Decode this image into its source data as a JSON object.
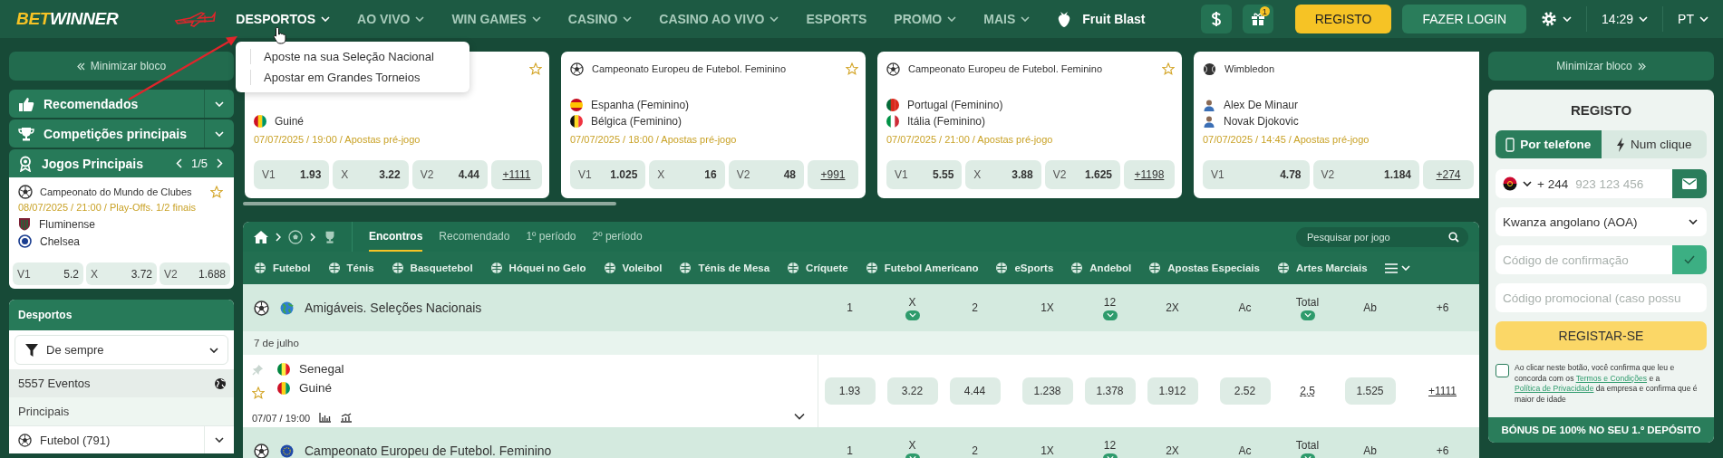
{
  "header": {
    "logo": [
      "BET",
      "WINNER"
    ],
    "nav": [
      {
        "label": "DESPORTOS",
        "selected": true,
        "menu": true
      },
      {
        "label": "AO VIVO",
        "selected": false,
        "menu": true
      },
      {
        "label": "WIN GAMES",
        "selected": false,
        "menu": true
      },
      {
        "label": "CASINO",
        "selected": false,
        "menu": true
      },
      {
        "label": "CASINO AO VIVO",
        "selected": false,
        "menu": true
      },
      {
        "label": "ESPORTS",
        "selected": false,
        "menu": false
      },
      {
        "label": "PROMO",
        "selected": false,
        "menu": true
      },
      {
        "label": "MAIS",
        "selected": false,
        "menu": true
      }
    ],
    "featured": "Fruit Blast",
    "gift_badge": "1",
    "register": "REGISTO",
    "login": "FAZER LOGIN",
    "time": "14:29",
    "language": "PT"
  },
  "nav_dropdown": [
    "Aposte na sua Seleção Nacional",
    "Apostar em Grandes Torneios"
  ],
  "left": {
    "minimize": "Minimizar bloco",
    "sections": [
      "Recomendados",
      "Competições principais"
    ],
    "top_games": {
      "title": "Jogos Principais",
      "page": "1/5",
      "league": "Campeonato do Mundo de Clubes",
      "info": "08/07/2025 / 21:00 / Play-Offs. 1/2 finais",
      "teams": [
        "Fluminense",
        "Chelsea"
      ],
      "odds": [
        {
          "label": "V1",
          "value": "5.2"
        },
        {
          "label": "X",
          "value": "3.72"
        },
        {
          "label": "V2",
          "value": "1.688"
        }
      ]
    },
    "sports": {
      "title": "Desportos",
      "filter": "De sempre",
      "events": "5557 Eventos",
      "group": "Principais",
      "items": [
        "Futebol (791)"
      ]
    }
  },
  "cards": [
    {
      "kind": "football",
      "teams": [
        "Guiné"
      ],
      "info": "07/07/2025 / 19:00 / Apostas pré-jogo",
      "odds": [
        {
          "label": "V1",
          "value": "1.93"
        },
        {
          "label": "X",
          "value": "3.22"
        },
        {
          "label": "V2",
          "value": "4.44"
        }
      ],
      "more": "+1111"
    },
    {
      "kind": "football",
      "league": "Campeonato Europeu de Futebol. Feminino",
      "teams": [
        "Espanha (Feminino)",
        "Bélgica (Feminino)"
      ],
      "info": "07/07/2025 / 18:00 / Apostas pré-jogo",
      "odds": [
        {
          "label": "V1",
          "value": "1.025"
        },
        {
          "label": "X",
          "value": "16"
        },
        {
          "label": "V2",
          "value": "48"
        }
      ],
      "more": "+991"
    },
    {
      "kind": "football",
      "league": "Campeonato Europeu de Futebol. Feminino",
      "teams": [
        "Portugal (Feminino)",
        "Itália (Feminino)"
      ],
      "info": "07/07/2025 / 21:00 / Apostas pré-jogo",
      "odds": [
        {
          "label": "V1",
          "value": "5.55"
        },
        {
          "label": "X",
          "value": "3.88"
        },
        {
          "label": "V2",
          "value": "1.625"
        }
      ],
      "more": "+1198"
    },
    {
      "kind": "tennis",
      "league": "Wimbledon",
      "teams": [
        "Alex De Minaur",
        "Novak Djokovic"
      ],
      "info": "07/07/2025 / 14:45 / Apostas pré-jogo",
      "odds": [
        {
          "label": "V1",
          "value": "4.78"
        },
        {
          "label": "V2",
          "value": "1.184"
        }
      ],
      "more": "+274"
    }
  ],
  "events": {
    "tabs": [
      {
        "label": "Encontros",
        "selected": true
      },
      {
        "label": "Recomendado",
        "selected": false
      },
      {
        "label": "1º período",
        "selected": false
      },
      {
        "label": "2º período",
        "selected": false
      }
    ],
    "search": {
      "placeholder": "Pesquisar por jogo"
    },
    "sports": [
      "Futebol",
      "Ténis",
      "Basquetebol",
      "Hóquei no Gelo",
      "Voleibol",
      "Ténis de Mesa",
      "Críquete",
      "Futebol Americano",
      "eSports",
      "Andebol",
      "Apostas Especiais",
      "Artes Marciais"
    ],
    "leagues": [
      {
        "name": "Amigáveis. Seleções Nacionais",
        "columns": [
          {
            "label": "1",
            "expandable": false
          },
          {
            "label": "X",
            "expandable": true
          },
          {
            "label": "2",
            "expandable": false
          },
          {
            "label": "1X",
            "expandable": false
          },
          {
            "label": "12",
            "expandable": true
          },
          {
            "label": "2X",
            "expandable": false
          },
          {
            "label": "Ac",
            "expandable": false
          },
          {
            "label": "Total",
            "expandable": true
          },
          {
            "label": "Ab",
            "expandable": false
          },
          {
            "label": "+6",
            "expandable": false
          }
        ],
        "date": "7 de julho",
        "matches": [
          {
            "teams": [
              "Senegal",
              "Guiné"
            ],
            "time": "07/07 / 19:00",
            "odds": [
              {
                "kind": "odd",
                "value": "1.93"
              },
              {
                "kind": "odd",
                "value": "3.22"
              },
              {
                "kind": "odd",
                "value": "4.44"
              },
              {
                "kind": "odd",
                "value": "1.238"
              },
              {
                "kind": "odd",
                "value": "1.378"
              },
              {
                "kind": "odd",
                "value": "1.912"
              },
              {
                "kind": "odd",
                "value": "2.52"
              },
              {
                "kind": "line",
                "value": "2.5"
              },
              {
                "kind": "odd",
                "value": "1.525"
              }
            ],
            "more": "+1111"
          }
        ]
      },
      {
        "name": "Campeonato Europeu de Futebol. Feminino",
        "columns": [
          {
            "label": "1",
            "expandable": false
          },
          {
            "label": "X",
            "expandable": true
          },
          {
            "label": "2",
            "expandable": false
          },
          {
            "label": "1X",
            "expandable": false
          },
          {
            "label": "12",
            "expandable": true
          },
          {
            "label": "2X",
            "expandable": false
          },
          {
            "label": "Ac",
            "expandable": false
          },
          {
            "label": "Total",
            "expandable": true
          },
          {
            "label": "Ab",
            "expandable": false
          },
          {
            "label": "+6",
            "expandable": false
          }
        ]
      }
    ]
  },
  "right": {
    "minimize": "Minimizar bloco",
    "title": "REGISTO",
    "tabs": [
      {
        "label": "Por telefone",
        "selected": true
      },
      {
        "label": "Num clique",
        "selected": false
      }
    ],
    "phone_code": "+ 244",
    "phone_placeholder": "923 123 456",
    "currency": "Kwanza angolano (AOA)",
    "code_placeholder": "Código de confirmação",
    "promo_placeholder": "Código promocional (caso possu",
    "submit": "REGISTAR-SE",
    "agree": false,
    "consent": {
      "before": "Ao clicar neste botão, você confirma que leu e concorda com os",
      "terms": "Termos e Condições",
      "middle": "e a",
      "privacy": "Política de Privacidade",
      "after": "da empresa e confirma que é maior de idade"
    },
    "bonus": "BÓNUS DE 100% NO SEU 1.º DEPÓSITO"
  }
}
